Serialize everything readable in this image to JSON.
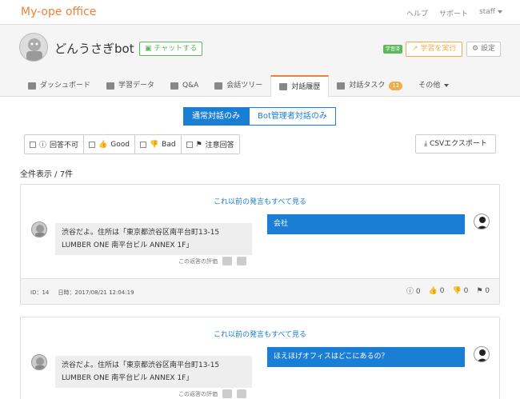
{
  "topbar": {
    "brand": "My-ope office",
    "nav": [
      "ヘルプ",
      "サポート",
      "staff"
    ]
  },
  "header": {
    "bot_name": "どんうさぎbot",
    "chat_button": "チャットする",
    "learned_badge": "学習済",
    "learn_button": "学習を実行",
    "settings_button": "設定"
  },
  "tabs": [
    {
      "label": "ダッシュボード",
      "icon": "dashboard-icon"
    },
    {
      "label": "学習データ",
      "icon": "list-icon"
    },
    {
      "label": "Q&A",
      "icon": "qa-icon"
    },
    {
      "label": "会話ツリー",
      "icon": "tree-icon"
    },
    {
      "label": "対話履歴",
      "icon": "history-icon",
      "active": true
    },
    {
      "label": "対話タスク",
      "icon": "task-icon",
      "badge": "11"
    },
    {
      "label": "その他",
      "icon": "chevron-down-icon"
    }
  ],
  "toggle": {
    "option_normal": "通常対話のみ",
    "option_admin": "Bot管理者対話のみ"
  },
  "filters": [
    "回答不可",
    "Good",
    "Bad",
    "注意回答"
  ],
  "csv_button": "CSVエクスポート",
  "count_text": "全件表示 / 7件",
  "conversations": [
    {
      "more_link": "これ以前の発言もすべて見る",
      "bot_answer": "渋谷だよ。住所は「東京都渋谷区南平台町13-15 LUMBER ONE 南平台ビル ANNEX 1F」",
      "user_question": "会社",
      "rating_label": "この返答の評価",
      "id_text": "ID：14",
      "date_text": "日時：2017/08/21 12:04:19",
      "counts": {
        "unanswered": "0",
        "good": "0",
        "bad": "0",
        "caution": "0"
      }
    },
    {
      "more_link": "これ以前の発言もすべて見る",
      "bot_answer": "渋谷だよ。住所は「東京都渋谷区南平台町13-15 LUMBER ONE 南平台ビル ANNEX 1F」",
      "user_question": "ほえほげオフィスはどこにあるの？",
      "rating_label": "この返答の評価"
    }
  ],
  "colors": {
    "brand": "#f0823c",
    "primary": "#1a7ed4",
    "success": "#5cb85c",
    "warning": "#f0ad4e"
  }
}
